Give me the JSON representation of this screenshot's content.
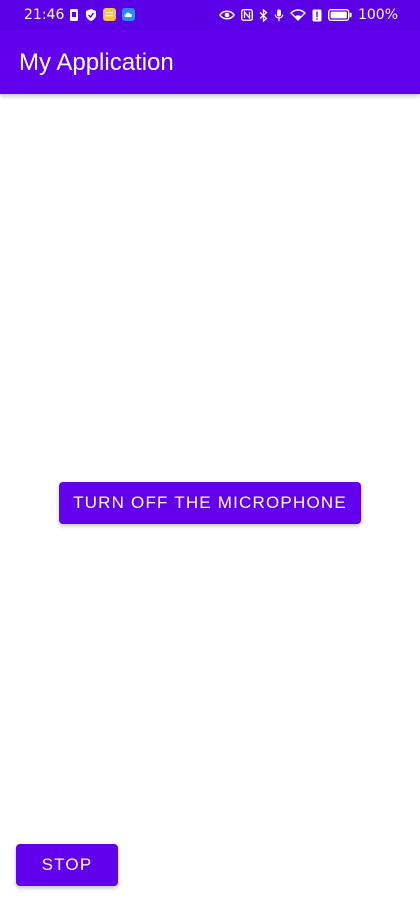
{
  "status_bar": {
    "time": "21:46",
    "battery": "100%",
    "left_icons": [
      "sim-icon",
      "shield-icon",
      "notes-app-icon",
      "cloud-app-icon"
    ],
    "right_icons": [
      "eye-icon",
      "nfc-icon",
      "bluetooth-icon",
      "microphone-icon",
      "wifi-icon",
      "alert-icon",
      "battery-icon"
    ],
    "background_color": "#5b00e6"
  },
  "app_bar": {
    "title": "My Application",
    "background_color": "#6200ee"
  },
  "main": {
    "microphone_button_label": "TURN OFF THE MICROPHONE",
    "stop_button_label": "STOP",
    "button_color": "#6200ee"
  }
}
